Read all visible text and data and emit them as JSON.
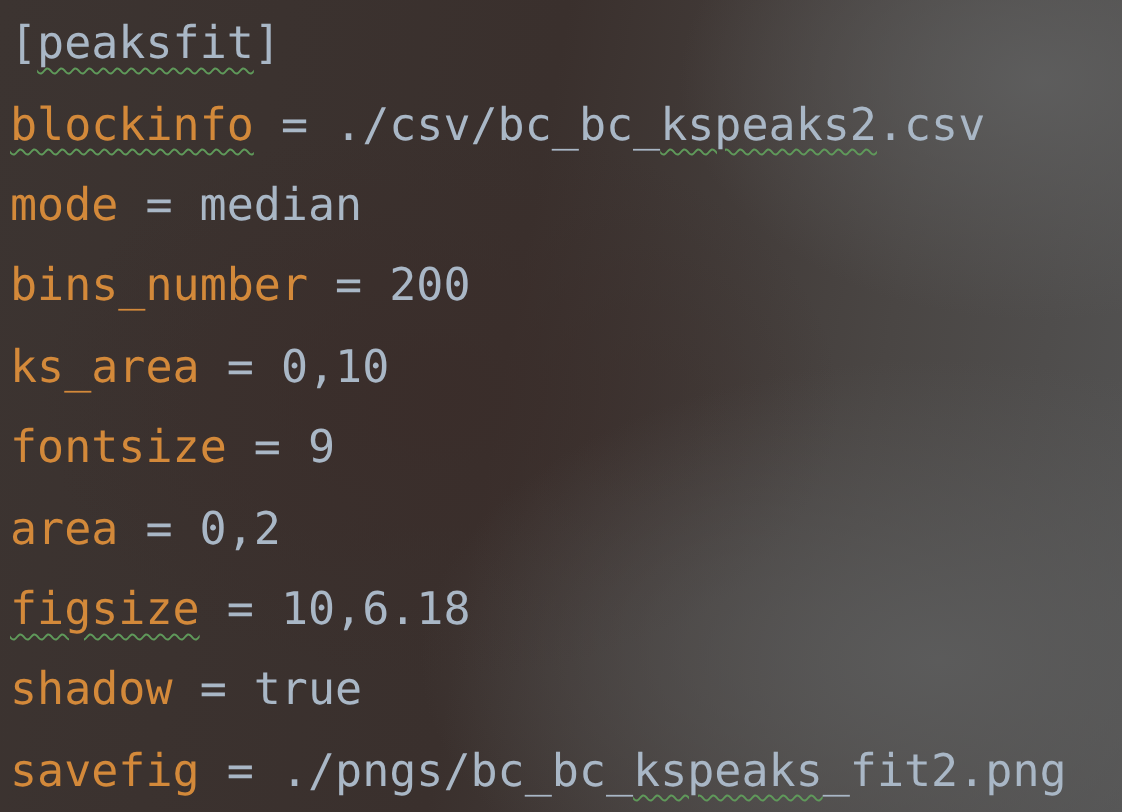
{
  "editor": {
    "lines": [
      {
        "kind": "section",
        "parts": [
          {
            "text": "[",
            "typo": false
          },
          {
            "text": "peaksfit",
            "typo": true
          },
          {
            "text": "]",
            "typo": false
          }
        ]
      },
      {
        "kind": "pair",
        "key": {
          "text": "blockinfo",
          "typo": true
        },
        "op": "=",
        "value": [
          {
            "text": "./csv/bc_bc_",
            "typo": false
          },
          {
            "text": "kspeaks2",
            "typo": true
          },
          {
            "text": ".csv",
            "typo": false
          }
        ]
      },
      {
        "kind": "pair",
        "key": {
          "text": "mode",
          "typo": false
        },
        "op": "=",
        "value": [
          {
            "text": "median",
            "typo": false
          }
        ]
      },
      {
        "kind": "pair",
        "key": {
          "text": "bins_number",
          "typo": false
        },
        "op": "=",
        "value": [
          {
            "text": "200",
            "typo": false
          }
        ]
      },
      {
        "kind": "pair",
        "key": {
          "text": "ks_area",
          "typo": false
        },
        "op": "=",
        "value": [
          {
            "text": "0,10",
            "typo": false
          }
        ]
      },
      {
        "kind": "pair",
        "key": {
          "text": "fontsize",
          "typo": false
        },
        "op": "=",
        "value": [
          {
            "text": "9",
            "typo": false
          }
        ]
      },
      {
        "kind": "pair",
        "key": {
          "text": "area",
          "typo": false
        },
        "op": "=",
        "value": [
          {
            "text": "0,2",
            "typo": false
          }
        ]
      },
      {
        "kind": "pair",
        "key": {
          "text": "figsize",
          "typo": true
        },
        "op": "=",
        "value": [
          {
            "text": "10,6.18",
            "typo": false
          }
        ]
      },
      {
        "kind": "pair",
        "key": {
          "text": "shadow",
          "typo": false
        },
        "op": "=",
        "value": [
          {
            "text": "true",
            "typo": false
          }
        ]
      },
      {
        "kind": "pair",
        "key": {
          "text": "savefig",
          "typo": false
        },
        "op": "=",
        "value": [
          {
            "text": "./pngs/bc_bc_",
            "typo": false
          },
          {
            "text": "kspeaks",
            "typo": true
          },
          {
            "text": "_fit2.png",
            "typo": false
          }
        ]
      }
    ]
  }
}
